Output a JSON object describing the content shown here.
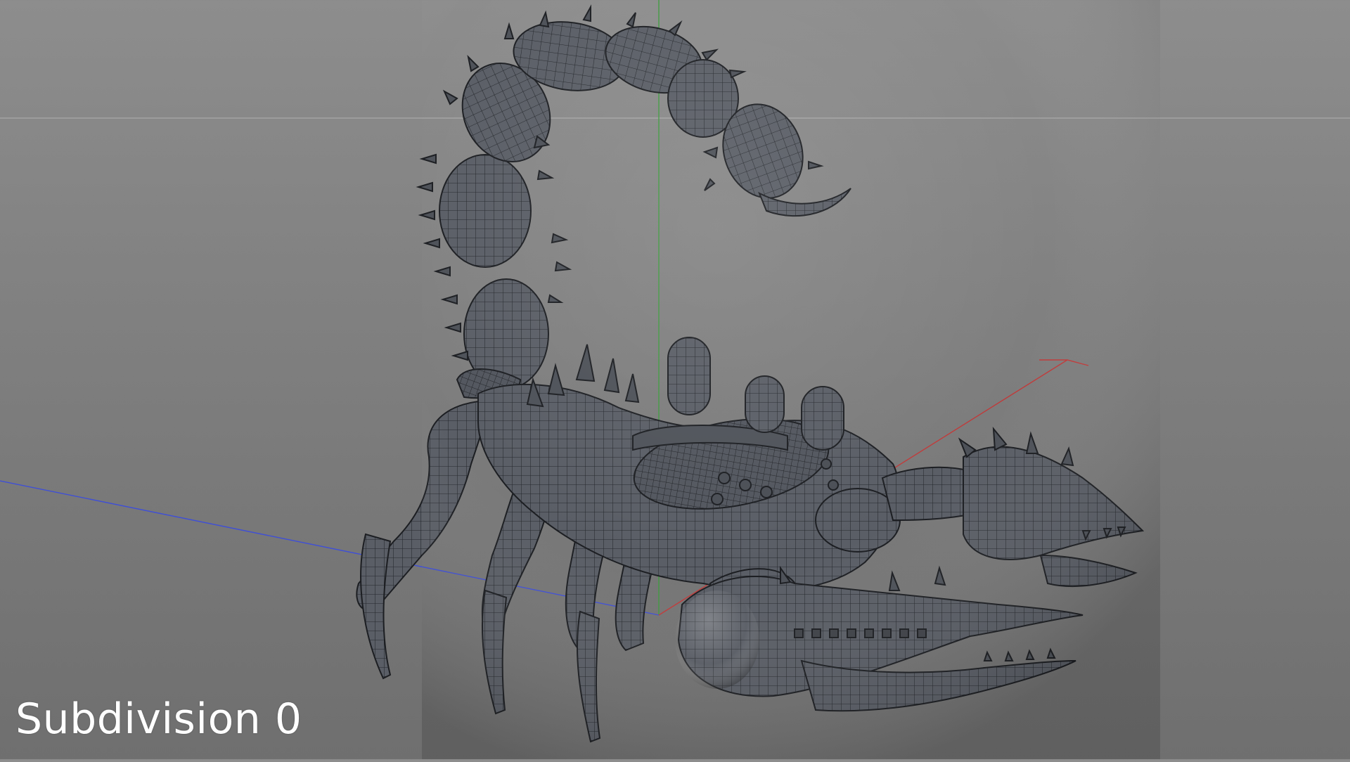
{
  "viewport": {
    "background_color": "#808080",
    "axis_colors": {
      "x_axis": "#c03a3a",
      "y_axis": "#3f9a3f",
      "z_axis": "#3f4fd6",
      "horizon": "#a8a8a8"
    },
    "model_color": "#565a62",
    "wire_color": "#1e2024"
  },
  "overlay": {
    "label": "Subdivision 0"
  }
}
